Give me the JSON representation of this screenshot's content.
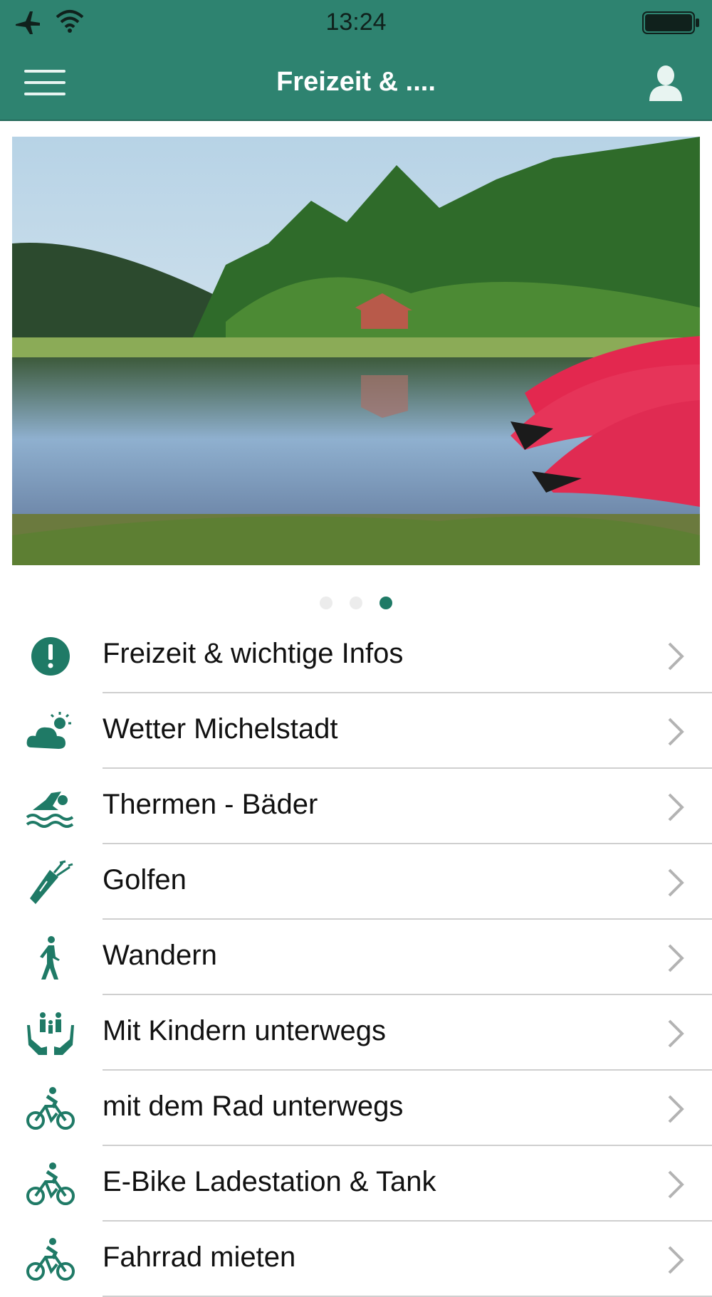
{
  "status_bar": {
    "time": "13:24",
    "airplane_icon": "airplane-icon",
    "wifi_icon": "wifi-icon",
    "battery_icon": "battery-icon"
  },
  "nav": {
    "title": "Freizeit & ....",
    "menu_icon": "hamburger-menu-icon",
    "profile_icon": "user-icon"
  },
  "carousel": {
    "page_count": 3,
    "active_page": 3,
    "image_description_icon": "lake-photo"
  },
  "colors": {
    "brand": "#2e8370",
    "accent": "#1f7a66",
    "text": "#111111",
    "separator": "#cfcfcf",
    "chevron": "#b3b3b3"
  },
  "items": [
    {
      "label": "Freizeit & wichtige Infos",
      "icon": "exclamation-circle-icon"
    },
    {
      "label": "Wetter Michelstadt",
      "icon": "cloud-sun-icon"
    },
    {
      "label": "Thermen - Bäder",
      "icon": "swimmer-icon"
    },
    {
      "label": "Golfen",
      "icon": "golf-bag-icon"
    },
    {
      "label": "Wandern",
      "icon": "hiker-icon"
    },
    {
      "label": "Mit Kindern unterwegs",
      "icon": "family-hands-icon"
    },
    {
      "label": "mit dem Rad unterwegs",
      "icon": "cyclist-icon"
    },
    {
      "label": "E-Bike Ladestation & Tank",
      "icon": "cyclist-icon"
    },
    {
      "label": "Fahrrad mieten",
      "icon": "cyclist-icon"
    }
  ]
}
